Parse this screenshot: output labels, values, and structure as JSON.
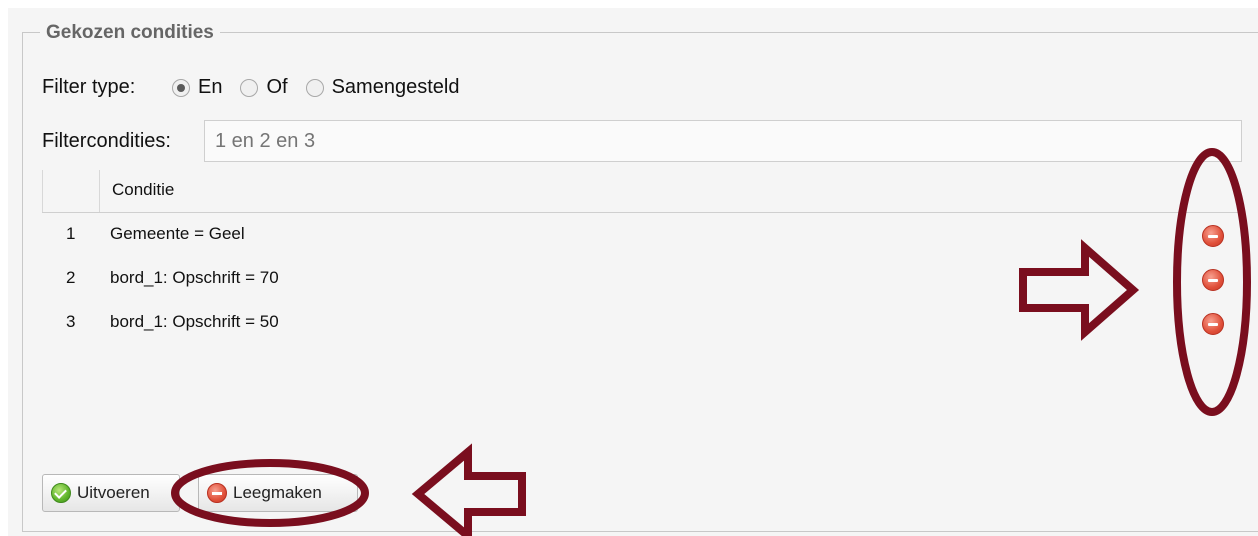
{
  "fieldset": {
    "legend": "Gekozen condities"
  },
  "filter_type": {
    "label": "Filter type:",
    "options": [
      {
        "label": "En",
        "checked": true
      },
      {
        "label": "Of",
        "checked": false
      },
      {
        "label": "Samengesteld",
        "checked": false
      }
    ]
  },
  "filter_conditions": {
    "label": "Filtercondities:",
    "placeholder": "1 en 2 en 3"
  },
  "grid": {
    "header": "Conditie",
    "rows": [
      {
        "num": "1",
        "condition": "Gemeente = Geel"
      },
      {
        "num": "2",
        "condition": "bord_1: Opschrift = 70"
      },
      {
        "num": "3",
        "condition": "bord_1: Opschrift = 50"
      }
    ]
  },
  "buttons": {
    "execute": "Uitvoeren",
    "clear": "Leegmaken"
  },
  "colors": {
    "annotation": "#7a0e1e",
    "remove": "#e0503a",
    "ok": "#5fb42b"
  }
}
